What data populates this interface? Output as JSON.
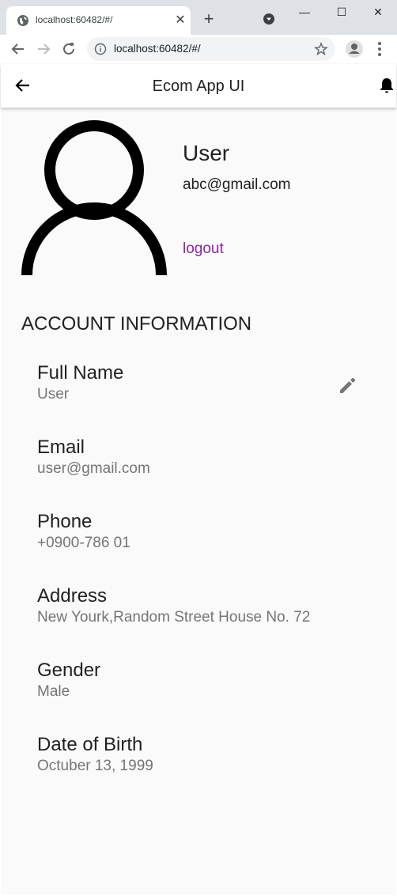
{
  "browser": {
    "tab_title": "localhost:60482/#/",
    "url": "localhost:60482/#/"
  },
  "appbar": {
    "title": "Ecom App UI"
  },
  "profile": {
    "name": "User",
    "email": "abc@gmail.com",
    "logout_label": "logout"
  },
  "account": {
    "section_title": "ACCOUNT INFORMATION",
    "items": [
      {
        "label": "Full Name",
        "value": "User"
      },
      {
        "label": "Email",
        "value": "user@gmail.com"
      },
      {
        "label": "Phone",
        "value": "+0900-786 01"
      },
      {
        "label": "Address",
        "value": "New Yourk,Random Street House No. 72"
      },
      {
        "label": "Gender",
        "value": "Male"
      },
      {
        "label": "Date of Birth",
        "value": "Octuber 13, 1999"
      }
    ]
  },
  "colors": {
    "accent_logout": "#8e24aa",
    "background": "#fafafa",
    "secondary_text": "#757575"
  },
  "icons": [
    "globe-icon",
    "close-icon",
    "plus-icon",
    "tab-search-icon",
    "minimize-icon",
    "maximize-icon",
    "window-close-icon",
    "back-arrow-icon",
    "forward-arrow-icon",
    "reload-icon",
    "info-icon",
    "star-icon",
    "profile-icon",
    "more-vert-icon",
    "app-back-icon",
    "bell-icon",
    "avatar-person-icon",
    "edit-pencil-icon"
  ]
}
